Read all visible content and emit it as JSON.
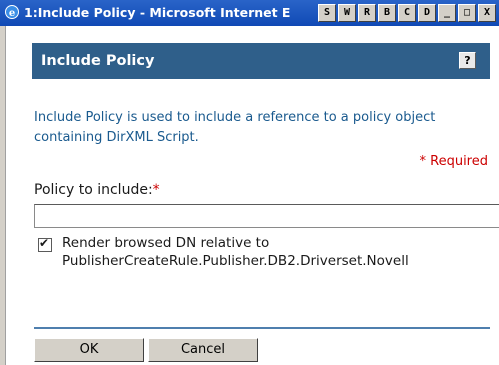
{
  "window": {
    "title": "1:Include Policy - Microsoft Internet E",
    "buttons": [
      {
        "label": "S",
        "name": "window-s-button"
      },
      {
        "label": "W",
        "name": "window-w-button"
      },
      {
        "label": "R",
        "name": "window-r-button"
      },
      {
        "label": "B",
        "name": "window-b-button"
      },
      {
        "label": "C",
        "name": "window-c-button"
      },
      {
        "label": "D",
        "name": "window-d-button"
      },
      {
        "label": "_",
        "name": "minimize-button"
      },
      {
        "label": "□",
        "name": "maximize-button"
      },
      {
        "label": "X",
        "name": "close-button"
      }
    ],
    "icon": "internet-explorer-icon"
  },
  "dialog": {
    "title": "Include Policy",
    "help_label": "?",
    "description": "Include Policy is used to include a reference to a policy object containing DirXML Script.",
    "required_note": "* Required",
    "field_label": "Policy to include:",
    "field_required_marker": "*",
    "policy_value": "",
    "checkbox_checked": true,
    "checkbox_label": "Render browsed DN relative to PublisherCreateRule.Publisher.DB2.Driverset.Novell",
    "ok_label": "OK",
    "cancel_label": "Cancel"
  },
  "colors": {
    "titlebar": "#1f5cc6",
    "dialog_header": "#2f5f8a",
    "description_text": "#1a5a8e",
    "required": "#cc0000",
    "divider": "#4f7fae"
  }
}
